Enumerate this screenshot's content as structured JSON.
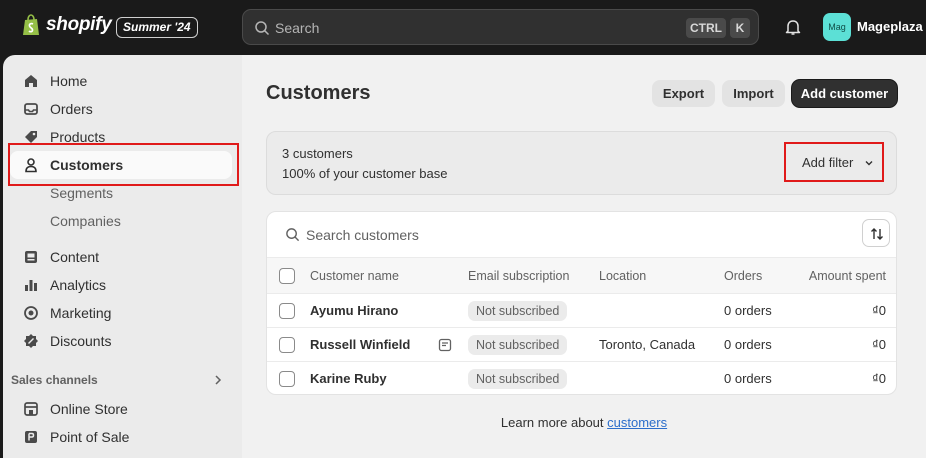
{
  "topbar": {
    "logo_text": "shopify",
    "edition": "Summer '24",
    "search_placeholder": "Search",
    "shortcut_ctrl": "CTRL",
    "shortcut_k": "K",
    "avatar_initials": "Mag",
    "store_name": "Mageplaza"
  },
  "sidebar": {
    "items": [
      {
        "label": "Home",
        "icon": "home-icon"
      },
      {
        "label": "Orders",
        "icon": "inbox-icon"
      },
      {
        "label": "Products",
        "icon": "tag-icon"
      },
      {
        "label": "Customers",
        "icon": "person-icon",
        "active": true
      },
      {
        "label": "Segments"
      },
      {
        "label": "Companies"
      },
      {
        "label": "Content",
        "icon": "content-icon"
      },
      {
        "label": "Analytics",
        "icon": "bar-chart-icon"
      },
      {
        "label": "Marketing",
        "icon": "target-icon"
      },
      {
        "label": "Discounts",
        "icon": "discount-icon"
      }
    ],
    "sales_channels_title": "Sales channels",
    "channels": [
      {
        "label": "Online Store",
        "icon": "store-icon"
      },
      {
        "label": "Point of Sale",
        "icon": "pos-icon"
      }
    ]
  },
  "main": {
    "title": "Customers",
    "export_label": "Export",
    "import_label": "Import",
    "add_customer_label": "Add customer",
    "summary": {
      "count_text": "3 customers",
      "base_text": "100% of your customer base",
      "add_filter_label": "Add filter"
    },
    "table": {
      "search_placeholder": "Search customers",
      "headers": [
        "Customer name",
        "Email subscription",
        "Location",
        "Orders",
        "Amount spent"
      ],
      "rows": [
        {
          "name": "Ayumu Hirano",
          "subscription": "Not subscribed",
          "location": "",
          "orders": "0 orders",
          "amount": "₫0"
        },
        {
          "name": "Russell Winfield",
          "subscription": "Not subscribed",
          "location": "Toronto, Canada",
          "orders": "0 orders",
          "amount": "₫0",
          "has_note": true
        },
        {
          "name": "Karine Ruby",
          "subscription": "Not subscribed",
          "location": "",
          "orders": "0 orders",
          "amount": "₫0"
        }
      ]
    },
    "learn_more_prefix": "Learn more about",
    "learn_more_link": "customers"
  },
  "colors": {
    "highlight": "#e01a1a",
    "link": "#2c6ecb",
    "primary_button": "#303030",
    "avatar": "#5ce0d6"
  }
}
